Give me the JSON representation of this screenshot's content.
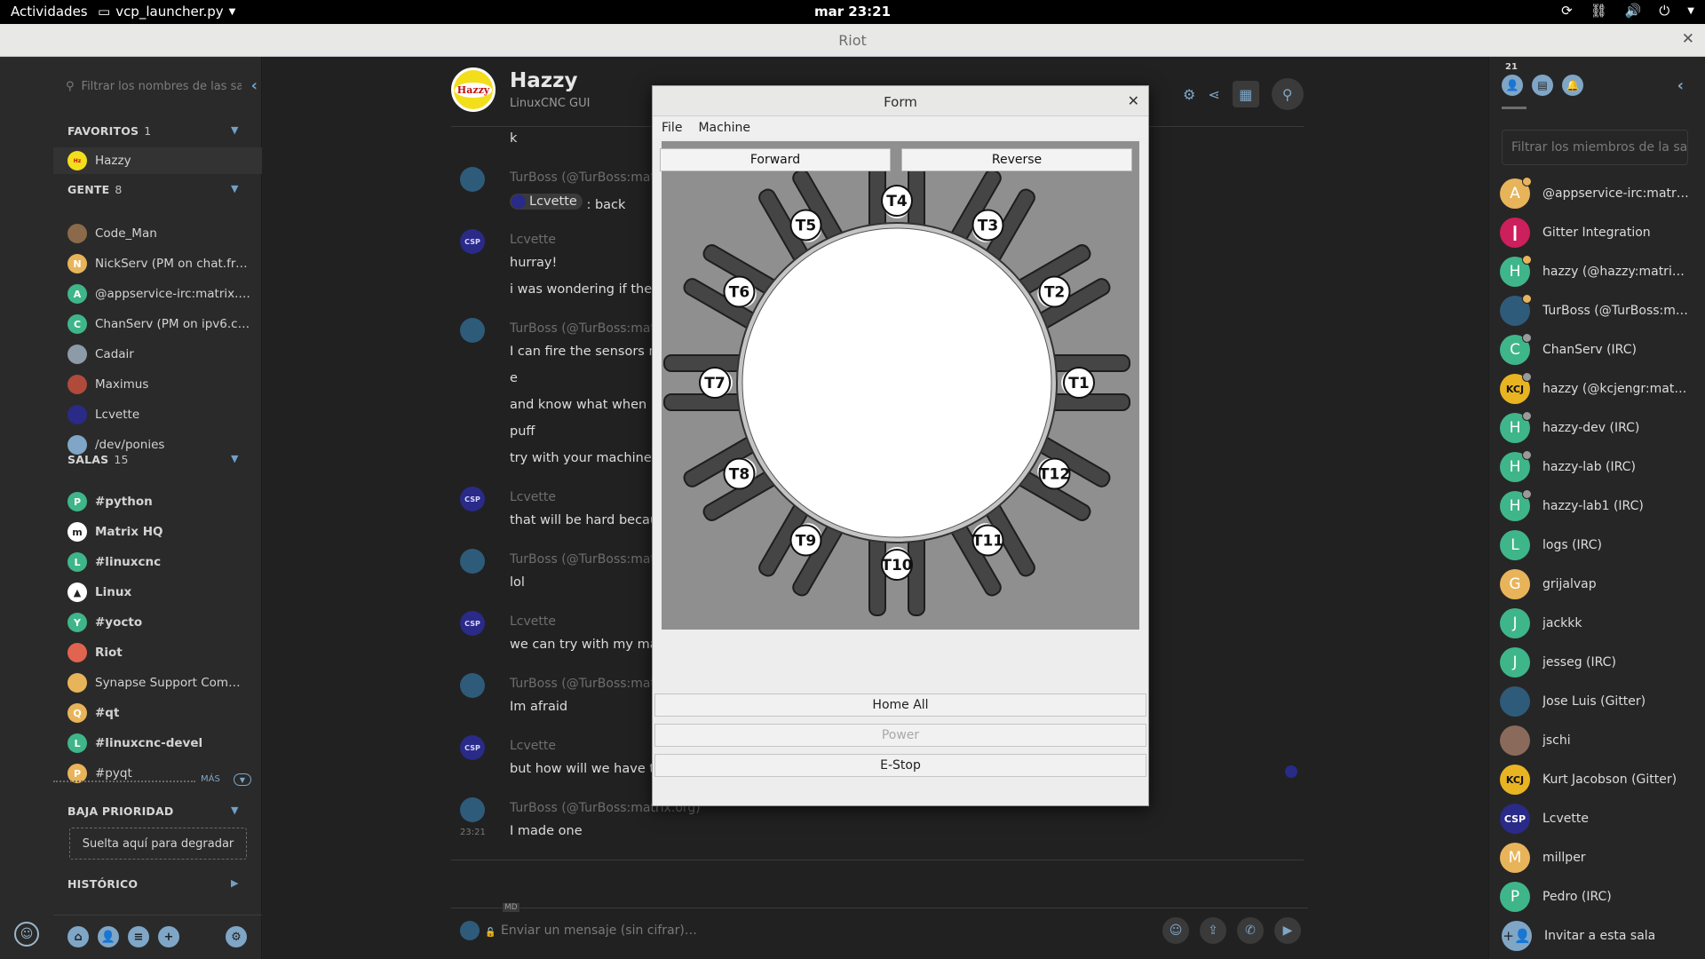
{
  "topbar": {
    "activities": "Actividades",
    "app_menu": "vcp_launcher.py",
    "clock": "mar 23:21"
  },
  "window": {
    "title": "Riot"
  },
  "left_panel": {
    "search_placeholder": "Filtrar los nombres de las salas",
    "favorites": {
      "title": "FAVORITOS",
      "count": "1",
      "items": [
        {
          "name": "Hazzy"
        }
      ]
    },
    "people": {
      "title": "GENTE",
      "count": "8",
      "items": [
        {
          "name": "Code_Man",
          "color": "#8a6a4a",
          "letter": ""
        },
        {
          "name": "NickServ (PM on chat.freenode.net)",
          "color": "#e8b45a",
          "letter": "N"
        },
        {
          "name": "@appservice-irc:matrix.org",
          "color": "#3fb58a",
          "letter": "A"
        },
        {
          "name": "ChanServ (PM on ipv6.chat.freenode.net)",
          "color": "#3fb58a",
          "letter": "C"
        },
        {
          "name": "Cadair",
          "color": "#8d9aa8",
          "letter": ""
        },
        {
          "name": "Maximus",
          "color": "#b04a3a",
          "letter": ""
        },
        {
          "name": "Lcvette",
          "color": "#2a2a88",
          "letter": ""
        },
        {
          "name": "/dev/ponies",
          "color": "#7fa6c6",
          "letter": ""
        }
      ]
    },
    "rooms": {
      "title": "SALAS",
      "count": "15",
      "items": [
        {
          "name": "#python",
          "color": "#3fb58a",
          "letter": "P",
          "bold": true
        },
        {
          "name": "Matrix HQ",
          "color": "#ffffff",
          "letter": "m",
          "bold": true
        },
        {
          "name": "#linuxcnc",
          "color": "#3fb58a",
          "letter": "L",
          "bold": true
        },
        {
          "name": "Linux",
          "color": "#ffffff",
          "letter": "▲",
          "bold": true
        },
        {
          "name": "#yocto",
          "color": "#3fb58a",
          "letter": "Y",
          "bold": true
        },
        {
          "name": "Riot",
          "color": "#e0644f",
          "letter": "",
          "bold": true
        },
        {
          "name": "Synapse Support Community",
          "color": "#e8b45a",
          "letter": "",
          "bold": false
        },
        {
          "name": "#qt",
          "color": "#e8b45a",
          "letter": "Q",
          "bold": true
        },
        {
          "name": "#linuxcnc-devel",
          "color": "#3fb58a",
          "letter": "L",
          "bold": true
        },
        {
          "name": "#pyqt",
          "color": "#e8b45a",
          "letter": "P",
          "bold": false
        }
      ]
    },
    "more_label": "MÁS",
    "low_priority": {
      "title": "BAJA PRIORIDAD"
    },
    "dropzone": "Suelta aquí para degradar",
    "historical": {
      "title": "HISTÓRICO"
    }
  },
  "room": {
    "name": "Hazzy",
    "topic": "LinuxCNC GUI",
    "logo_text": "Hazzy"
  },
  "messages": {
    "m0": {
      "body": "k"
    },
    "m1": {
      "sender": "TurBoss (@TurBoss:matrix.org)",
      "pill": "Lcvette",
      "body": ": back"
    },
    "m2": {
      "sender": "Lcvette",
      "lines": [
        "hurray!",
        "i was wondering if there"
      ]
    },
    "m3": {
      "sender": "TurBoss (@TurBoss:matrix.org)",
      "lines": [
        "I can fire the sensors ma",
        "e",
        "and know what when",
        "puff",
        "try with your machine"
      ]
    },
    "m4": {
      "sender": "Lcvette",
      "lines": [
        "that will be hard becaus"
      ]
    },
    "m5": {
      "sender": "TurBoss (@TurBoss:matrix.org)",
      "lines": [
        "lol"
      ]
    },
    "m6": {
      "sender": "Lcvette",
      "lines": [
        "we can try with my macl"
      ]
    },
    "m7": {
      "sender": "TurBoss (@TurBoss:matrix.org)",
      "lines": [
        "Im afraid"
      ]
    },
    "m8": {
      "sender": "Lcvette",
      "lines": [
        "but how will we have th"
      ]
    },
    "m9": {
      "sender": "TurBoss (@TurBoss:matrix.org)",
      "time": "23:21",
      "lines": [
        "I made one"
      ]
    },
    "avatar_text": "CSP"
  },
  "composer": {
    "placeholder": "Enviar un mensaje (sin cifrar)…"
  },
  "members": {
    "count": "21",
    "search_placeholder": "Filtrar los miembros de la sala",
    "list": [
      {
        "name": "@appservice-irc:matrix.org",
        "letter": "A",
        "color": "#e8b45a",
        "badge": "gold"
      },
      {
        "name": "Gitter Integration",
        "letter": "❙",
        "color": "#cc1f5c",
        "badge": ""
      },
      {
        "name": "hazzy (@hazzy:matrix.org)",
        "letter": "H",
        "color": "#3fb58a",
        "badge": "gold"
      },
      {
        "name": "TurBoss (@TurBoss:matrix.org)",
        "letter": "",
        "color": "#2f5b7a",
        "badge": "gold"
      },
      {
        "name": "ChanServ (IRC)",
        "letter": "C",
        "color": "#3fb58a",
        "badge": "grey"
      },
      {
        "name": "hazzy (@kcjengr:matrix.org)",
        "letter": "KCJ",
        "color": "#e8b422",
        "badge": "grey"
      },
      {
        "name": "hazzy-dev (IRC)",
        "letter": "H",
        "color": "#3fb58a",
        "badge": "grey"
      },
      {
        "name": "hazzy-lab (IRC)",
        "letter": "H",
        "color": "#3fb58a",
        "badge": "grey"
      },
      {
        "name": "hazzy-lab1 (IRC)",
        "letter": "H",
        "color": "#3fb58a",
        "badge": "grey"
      },
      {
        "name": "logs (IRC)",
        "letter": "L",
        "color": "#3fb58a",
        "badge": ""
      },
      {
        "name": "grijalvap",
        "letter": "G",
        "color": "#e8b45a",
        "badge": ""
      },
      {
        "name": "jackkk",
        "letter": "J",
        "color": "#3fb58a",
        "badge": ""
      },
      {
        "name": "jesseg (IRC)",
        "letter": "J",
        "color": "#3fb58a",
        "badge": ""
      },
      {
        "name": "Jose Luis (Gitter)",
        "letter": "",
        "color": "#2f5b7a",
        "badge": ""
      },
      {
        "name": "jschi",
        "letter": "",
        "color": "#8a6a5a",
        "badge": ""
      },
      {
        "name": "Kurt Jacobson (Gitter)",
        "letter": "KCJ",
        "color": "#e8b422",
        "badge": ""
      },
      {
        "name": "Lcvette",
        "letter": "CSP",
        "color": "#2a2a88",
        "badge": ""
      },
      {
        "name": "millper",
        "letter": "M",
        "color": "#e8b45a",
        "badge": ""
      },
      {
        "name": "Pedro (IRC)",
        "letter": "P",
        "color": "#3fb58a",
        "badge": ""
      }
    ],
    "invite": "Invitar a esta sala"
  },
  "form": {
    "title": "Form",
    "menu": [
      "File",
      "Machine"
    ],
    "forward": "Forward",
    "reverse": "Reverse",
    "tools": [
      "T1",
      "T2",
      "T3",
      "T4",
      "T5",
      "T6",
      "T7",
      "T8",
      "T9",
      "T10",
      "T11",
      "T12"
    ],
    "home_all": "Home All",
    "power": "Power",
    "estop": "E-Stop"
  }
}
